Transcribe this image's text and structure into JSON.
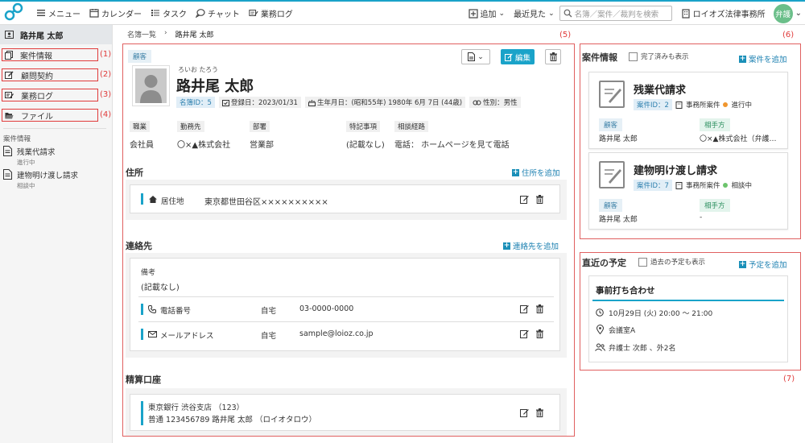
{
  "topnav": {
    "menu": "メニュー",
    "calendar": "カレンダー",
    "task": "タスク",
    "chat": "チャット",
    "worklog": "業務ログ",
    "add": "追加",
    "recent": "最近見た",
    "search_placeholder": "名簿／案件／裁判を検索",
    "office": "ロイオズ法律事務所",
    "avatar": "弁護"
  },
  "sidebar": {
    "person": "路井尾 太郎",
    "items": [
      {
        "label": "案件情報",
        "num": "(1)"
      },
      {
        "label": "顧問契約",
        "num": "(2)"
      },
      {
        "label": "業務ログ",
        "num": "(3)"
      },
      {
        "label": "ファイル",
        "num": "(4)"
      }
    ],
    "cases_title": "案件情報",
    "cases": [
      {
        "title": "残業代請求",
        "status": "進行中"
      },
      {
        "title": "建物明け渡し請求",
        "status": "相談中"
      }
    ]
  },
  "breadcrumb": {
    "root": "名簿一覧",
    "current": "路井尾 太郎"
  },
  "labels": {
    "main": "(5)",
    "cases_panel": "(6)",
    "schedule_panel": "(7)"
  },
  "profile": {
    "type_tag": "顧客",
    "furigana": "ろいお たろう",
    "name": "路井尾 太郎",
    "edit_label": "編集",
    "id_badge": "名簿ID：5",
    "registered": "登録日：2023/01/31",
    "birthday": "生年月日：(昭和55年) 1980年 6月 7日 (44歳)",
    "gender": "性別：男性",
    "fields": [
      {
        "label": "職業",
        "value": "会社員"
      },
      {
        "label": "勤務先",
        "value": "〇×▲株式会社"
      },
      {
        "label": "部署",
        "value": "営業部"
      },
      {
        "label": "特記事項",
        "value": "(記載なし)"
      },
      {
        "label": "相談経路",
        "value": "電話： ホームページを見て電話"
      }
    ]
  },
  "address": {
    "title": "住所",
    "add": "住所を追加",
    "type": "居住地",
    "value": "東京都世田谷区××××××××××"
  },
  "contact": {
    "title": "連絡先",
    "add": "連絡先を追加",
    "note_label": "備考",
    "note_value": "(記載なし)",
    "rows": [
      {
        "label": "電話番号",
        "kind": "自宅",
        "value": "03-0000-0000"
      },
      {
        "label": "メールアドレス",
        "kind": "自宅",
        "value": "sample@loioz.co.jp"
      }
    ]
  },
  "bank": {
    "title": "精算口座",
    "line1": "東京銀行 渋谷支店 （123）",
    "line2": "普通 123456789 路井尾 太郎 （ロイオタロウ）"
  },
  "cases_panel": {
    "title": "案件情報",
    "show_completed": "完了済みも表示",
    "add": "案件を追加",
    "cards": [
      {
        "title": "残業代請求",
        "id": "案件ID：2",
        "office": "事務所案件",
        "status": "進行中",
        "status_color": "#f0962e",
        "role1": "顧客",
        "name1": "路井尾 太郎",
        "role2": "相手方",
        "name2": "〇×▲株式会社（弁護…"
      },
      {
        "title": "建物明け渡し請求",
        "id": "案件ID：7",
        "office": "事務所案件",
        "status": "相談中",
        "status_color": "#6cc46c",
        "role1": "顧客",
        "name1": "路井尾 太郎",
        "role2": "相手方",
        "name2": "-"
      }
    ]
  },
  "schedule": {
    "title": "直近の予定",
    "show_past": "過去の予定も表示",
    "add": "予定を追加",
    "event_title": "事前打ち合わせ",
    "time": "10月29日 (火) 20:00 ～ 21:00",
    "place": "会議室A",
    "people": "弁護士 次郎 、外2名"
  },
  "colors": {
    "accent": "#1aa3c9",
    "highlight": "#e03b3b"
  }
}
